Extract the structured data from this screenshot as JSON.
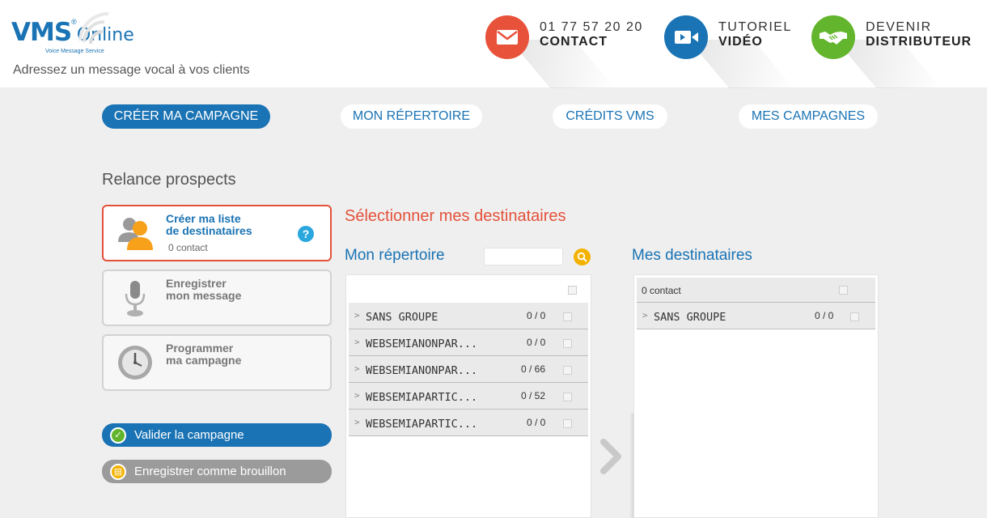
{
  "header": {
    "logo_vms": "VMS",
    "logo_reg": "®",
    "logo_online": "Online",
    "logo_tagline": "Voice Message Service",
    "slogan": "Adressez un message vocal à vos clients",
    "contact": {
      "line1": "01 77 57 20 20",
      "line2": "CONTACT",
      "icon": "envelope-icon",
      "color": "#e8523a"
    },
    "tutoriel": {
      "line1": "TUTORIEL",
      "line2": "VIDÉO",
      "icon": "video-camera-icon",
      "color": "#1a73b4"
    },
    "distributeur": {
      "line1": "DEVENIR",
      "line2": "DISTRIBUTEUR",
      "icon": "handshake-icon",
      "color": "#63b52d"
    }
  },
  "nav": {
    "creer": "CRÉER MA CAMPAGNE",
    "repertoire": "MON RÉPERTOIRE",
    "credits": "CRÉDITS VMS",
    "campagnes": "MES CAMPAGNES"
  },
  "campaign_title": "Relance prospects",
  "steps": [
    {
      "line1": "Créer ma liste",
      "line2": "de destinataires",
      "sub": "0 contact",
      "icon": "users-icon"
    },
    {
      "line1": "Enregistrer",
      "line2": "mon message",
      "icon": "microphone-icon"
    },
    {
      "line1": "Programmer",
      "line2": "ma campagne",
      "icon": "clock-icon"
    }
  ],
  "actions": {
    "valider": "Valider la campagne",
    "brouillon": "Enregistrer comme brouillon"
  },
  "section_title": "Sélectionner mes destinataires",
  "repertoire": {
    "title": "Mon répertoire",
    "search_value": "",
    "groups": [
      {
        "name": "SANS GROUPE",
        "count": "0 / 0"
      },
      {
        "name": "WEBSEMIANONPAR...",
        "count": "0 / 0"
      },
      {
        "name": "WEBSEMIANONPAR...",
        "count": "0 / 66"
      },
      {
        "name": "WEBSEMIAPARTIC...",
        "count": "0 / 52"
      },
      {
        "name": "WEBSEMIAPARTIC...",
        "count": "0 / 0"
      }
    ]
  },
  "destinataires": {
    "title": "Mes destinataires",
    "contact_count": "0 contact",
    "groups": [
      {
        "name": "SANS GROUPE",
        "count": "0 / 0"
      }
    ]
  },
  "colors": {
    "brand_blue": "#1a73b4",
    "accent_red": "#e4513a",
    "green": "#63b52d",
    "background": "#efefef"
  }
}
